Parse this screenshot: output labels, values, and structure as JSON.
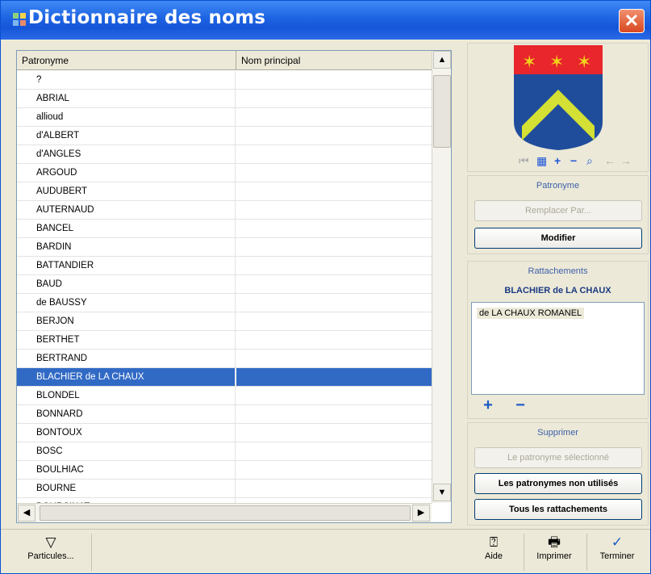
{
  "window": {
    "title": "Dictionnaire des noms",
    "close_symbol": "✕"
  },
  "list": {
    "columns": [
      "Patronyme",
      "Nom principal"
    ],
    "rows": [
      "?",
      "ABRIAL",
      "allioud",
      "d'ALBERT",
      "d'ANGLES",
      "ARGOUD",
      "AUDUBERT",
      "AUTERNAUD",
      "BANCEL",
      "BARDIN",
      "BATTANDIER",
      "BAUD",
      "de BAUSSY",
      "BERJON",
      "BERTHET",
      "BERTRAND",
      "BLACHIER de LA CHAUX",
      "BLONDEL",
      "BONNARD",
      "BONTOUX",
      "BOSC",
      "BOULHIAC",
      "BOURNE",
      "BOURSINAT"
    ],
    "selected_index": 16,
    "scroll_up": "▲",
    "scroll_down": "▼",
    "scroll_left": "◀",
    "scroll_right": "▶"
  },
  "crest": {
    "colors": {
      "chief": "#e8262b",
      "field": "#1f4d9c",
      "chevron": "#d4e033",
      "stars": "#f2d21a"
    },
    "tool_icons": [
      "first-icon",
      "grid-icon",
      "plus-icon",
      "minus-icon",
      "zoom-icon",
      "back-icon",
      "forward-icon"
    ]
  },
  "patronyme_group": {
    "title": "Patronyme",
    "replace_label": "Remplacer Par...",
    "modify_label": "Modifier"
  },
  "rattachements_group": {
    "title": "Rattachements",
    "current_name": "BLACHIER de LA CHAUX",
    "items": [
      "de LA CHAUX ROMANEL"
    ],
    "add_symbol": "+",
    "remove_symbol": "−"
  },
  "supprimer_group": {
    "title": "Supprimer",
    "selected_label": "Le patronyme sélectionné",
    "unused_label": "Les patronymes non utilisés",
    "all_links_label": "Tous les rattachements"
  },
  "bottom": {
    "particules_label": "Particules...",
    "aide_label": "Aide",
    "imprimer_label": "Imprimer",
    "terminer_label": "Terminer"
  },
  "colors": {
    "title_bar": "#1d63e2",
    "selection": "#316ac5",
    "window_bg": "#ece9d8"
  }
}
